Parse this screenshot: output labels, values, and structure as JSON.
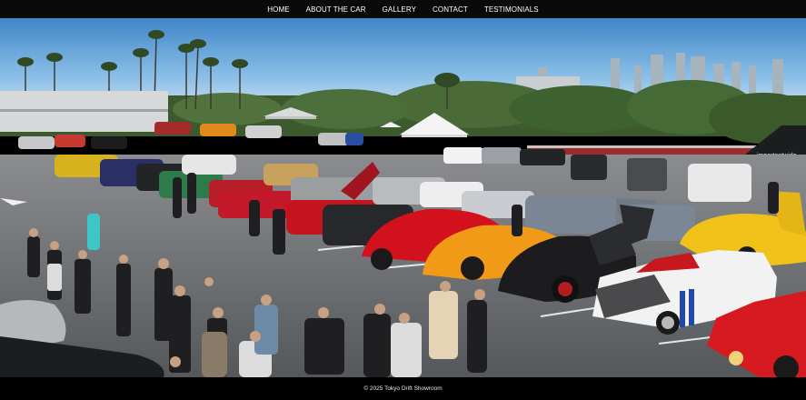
{
  "nav": {
    "items": [
      {
        "label": "HOME"
      },
      {
        "label": "ABOUT THE CAR"
      },
      {
        "label": "GALLERY"
      },
      {
        "label": "CONTACT"
      },
      {
        "label": "TESTIMONIALS"
      }
    ]
  },
  "hero": {
    "banner_text": "importantwide"
  },
  "footer": {
    "copyright": "© 2025 Tokyo Drift Showroom"
  },
  "colors": {
    "nav_bg": "#0a0a0a",
    "footer_bg": "#000000",
    "sky": "#7fb8e6",
    "lot": "#6d6f72"
  }
}
